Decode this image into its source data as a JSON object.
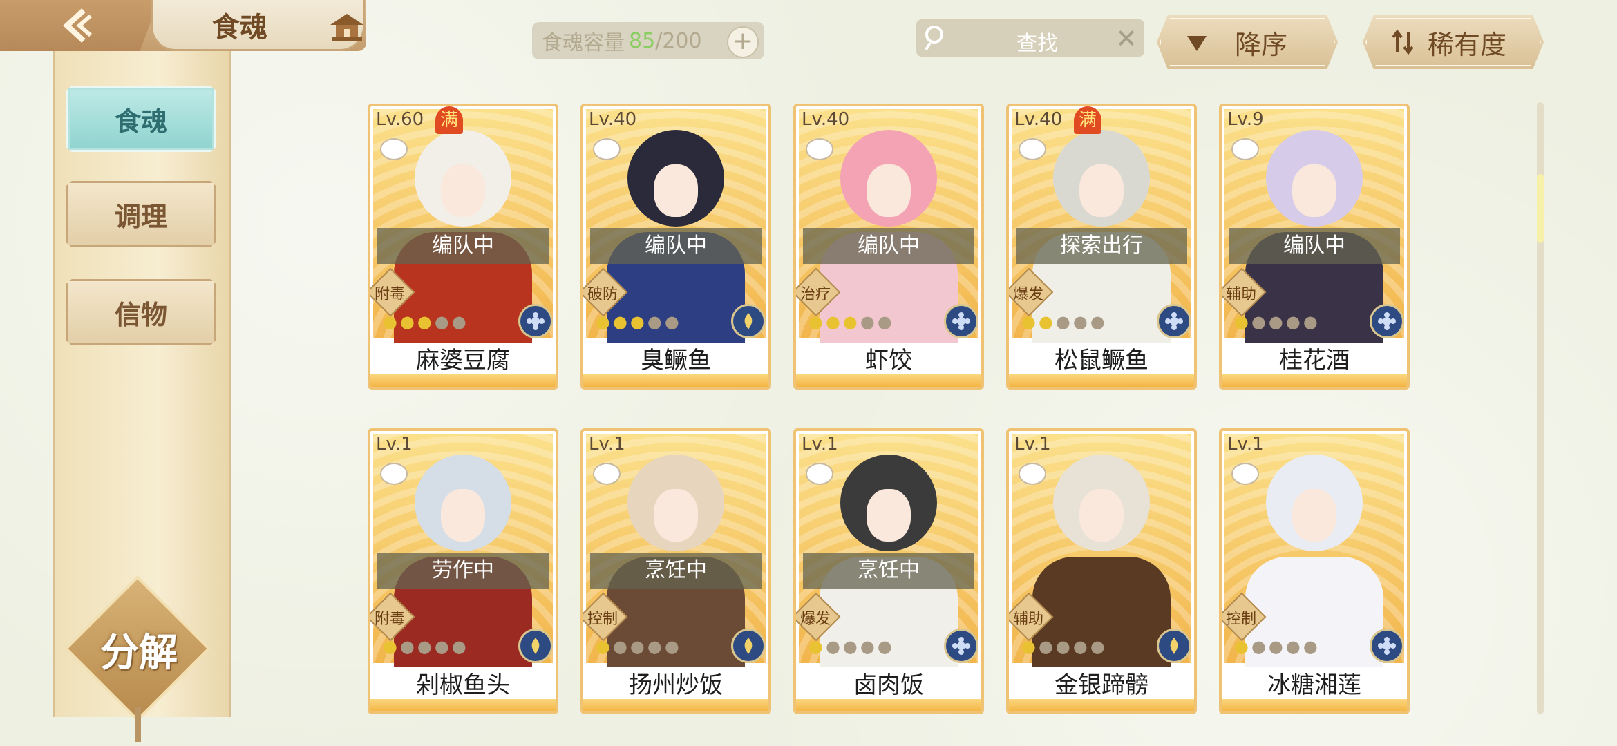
{
  "header": {
    "title": "食魂",
    "back_icon": "back-arrow-icon",
    "home_icon": "pavilion-icon"
  },
  "capacity": {
    "label": "食魂容量",
    "current": "85",
    "separator_max": "/200",
    "add": "+"
  },
  "search": {
    "placeholder": "查找",
    "clear": "✕"
  },
  "sort": {
    "order_label": "降序",
    "rarity_label": "稀有度"
  },
  "sidebar": {
    "items": [
      {
        "label": "食魂",
        "active": true
      },
      {
        "label": "调理",
        "active": false
      },
      {
        "label": "信物",
        "active": false
      }
    ],
    "decompose_label": "分解"
  },
  "cards": [
    {
      "level": "Lv.60",
      "full": "满",
      "status": "编队中",
      "role": "附毒",
      "stars": 3,
      "name": "麻婆豆腐",
      "element": "blue"
    },
    {
      "level": "Lv.40",
      "full": "",
      "status": "编队中",
      "role": "破防",
      "stars": 3,
      "name": "臭鳜鱼",
      "element": "gold"
    },
    {
      "level": "Lv.40",
      "full": "",
      "status": "编队中",
      "role": "治疗",
      "stars": 3,
      "name": "虾饺",
      "element": "blue"
    },
    {
      "level": "Lv.40",
      "full": "满",
      "status": "探索出行",
      "role": "爆发",
      "stars": 2,
      "name": "松鼠鳜鱼",
      "element": "blue"
    },
    {
      "level": "Lv.9",
      "full": "",
      "status": "编队中",
      "role": "辅助",
      "stars": 1,
      "name": "桂花酒",
      "element": "blue"
    },
    {
      "level": "Lv.1",
      "full": "",
      "status": "劳作中",
      "role": "附毒",
      "stars": 1,
      "name": "剁椒鱼头",
      "element": "gold"
    },
    {
      "level": "Lv.1",
      "full": "",
      "status": "烹饪中",
      "role": "控制",
      "stars": 1,
      "name": "扬州炒饭",
      "element": "gold"
    },
    {
      "level": "Lv.1",
      "full": "",
      "status": "烹饪中",
      "role": "爆发",
      "stars": 1,
      "name": "卤肉饭",
      "element": "blue"
    },
    {
      "level": "Lv.1",
      "full": "",
      "status": "",
      "role": "辅助",
      "stars": 1,
      "name": "金银蹄髈",
      "element": "gold"
    },
    {
      "level": "Lv.1",
      "full": "",
      "status": "",
      "role": "控制",
      "stars": 1,
      "name": "冰糖湘莲",
      "element": "blue"
    }
  ],
  "colors": {
    "card_border": "#f0c374",
    "accent_green": "#8acd62",
    "sidebar_active": "#8fd3cf"
  }
}
